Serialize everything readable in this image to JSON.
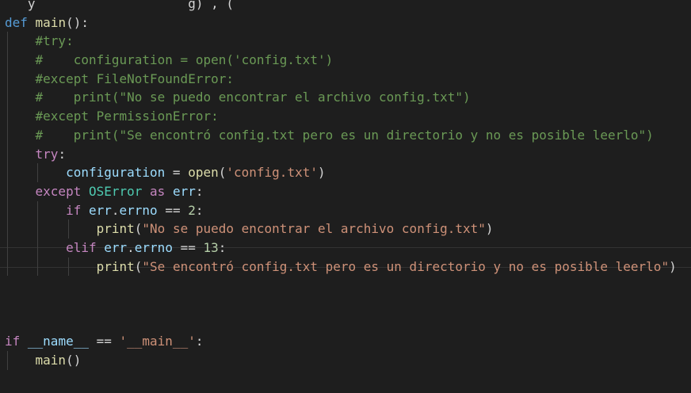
{
  "editor": {
    "language": "python",
    "theme_colors": {
      "background": "#1e1e1e",
      "keyword": "#569cd6",
      "control": "#c586c0",
      "function": "#dcdcaa",
      "variable": "#9cdcfe",
      "class": "#4ec9b0",
      "string": "#ce9178",
      "number": "#b5cea8",
      "comment": "#6a9955",
      "text": "#d4d4d4"
    },
    "lines": [
      {
        "indent": 0,
        "tokens": [
          {
            "t": "   y                    g) , ("
          }
        ],
        "cls": "op"
      },
      {
        "indent": 0,
        "tokens": [
          {
            "t": "def",
            "c": "kw"
          },
          {
            "t": " "
          },
          {
            "t": "main",
            "c": "fn"
          },
          {
            "t": "():"
          }
        ]
      },
      {
        "indent": 1,
        "tokens": [
          {
            "t": "#try:",
            "c": "cmt"
          }
        ]
      },
      {
        "indent": 1,
        "tokens": [
          {
            "t": "#    configuration = open('config.txt')",
            "c": "cmt"
          }
        ]
      },
      {
        "indent": 1,
        "tokens": [
          {
            "t": "#except FileNotFoundError:",
            "c": "cmt"
          }
        ]
      },
      {
        "indent": 1,
        "tokens": [
          {
            "t": "#    print(\"No se puedo encontrar el archivo config.txt\")",
            "c": "cmt"
          }
        ]
      },
      {
        "indent": 1,
        "tokens": [
          {
            "t": "#except PermissionError:",
            "c": "cmt"
          }
        ]
      },
      {
        "indent": 1,
        "tokens": [
          {
            "t": "#    print(\"Se encontró config.txt pero es un directorio y no es posible leerlo\")",
            "c": "cmt"
          }
        ]
      },
      {
        "indent": 1,
        "tokens": [
          {
            "t": "try",
            "c": "ctl"
          },
          {
            "t": ":"
          }
        ]
      },
      {
        "indent": 2,
        "tokens": [
          {
            "t": "configuration",
            "c": "var"
          },
          {
            "t": " = "
          },
          {
            "t": "open",
            "c": "fn"
          },
          {
            "t": "("
          },
          {
            "t": "'config.txt'",
            "c": "str"
          },
          {
            "t": ")"
          }
        ]
      },
      {
        "indent": 1,
        "tokens": [
          {
            "t": "except",
            "c": "ctl"
          },
          {
            "t": " "
          },
          {
            "t": "OSError",
            "c": "cls"
          },
          {
            "t": " "
          },
          {
            "t": "as",
            "c": "ctl"
          },
          {
            "t": " "
          },
          {
            "t": "err",
            "c": "var"
          },
          {
            "t": ":"
          }
        ]
      },
      {
        "indent": 2,
        "tokens": [
          {
            "t": "if",
            "c": "ctl"
          },
          {
            "t": " "
          },
          {
            "t": "err",
            "c": "var"
          },
          {
            "t": "."
          },
          {
            "t": "errno",
            "c": "var"
          },
          {
            "t": " == "
          },
          {
            "t": "2",
            "c": "num"
          },
          {
            "t": ":"
          }
        ]
      },
      {
        "indent": 3,
        "tokens": [
          {
            "t": "print",
            "c": "fn"
          },
          {
            "t": "("
          },
          {
            "t": "\"No se puedo encontrar el archivo config.txt\"",
            "c": "str"
          },
          {
            "t": ")"
          }
        ]
      },
      {
        "indent": 2,
        "tokens": [
          {
            "t": "elif",
            "c": "ctl"
          },
          {
            "t": " "
          },
          {
            "t": "err",
            "c": "var"
          },
          {
            "t": "."
          },
          {
            "t": "errno",
            "c": "var"
          },
          {
            "t": " == "
          },
          {
            "t": "13",
            "c": "num"
          },
          {
            "t": ":"
          }
        ]
      },
      {
        "indent": 3,
        "tokens": [
          {
            "t": "print",
            "c": "fn"
          },
          {
            "t": "("
          },
          {
            "t": "\"Se encontró config.txt pero es un directorio y no es posible leerlo\"",
            "c": "str"
          },
          {
            "t": ")"
          }
        ]
      },
      {
        "indent": 0,
        "tokens": []
      },
      {
        "indent": 0,
        "tokens": []
      },
      {
        "indent": 0,
        "tokens": []
      },
      {
        "indent": 0,
        "tokens": [
          {
            "t": "if",
            "c": "ctl"
          },
          {
            "t": " "
          },
          {
            "t": "__name__",
            "c": "dnd"
          },
          {
            "t": " == "
          },
          {
            "t": "'__main__'",
            "c": "str"
          },
          {
            "t": ":"
          }
        ]
      },
      {
        "indent": 1,
        "tokens": [
          {
            "t": "main",
            "c": "fn"
          },
          {
            "t": "()"
          }
        ]
      }
    ]
  }
}
